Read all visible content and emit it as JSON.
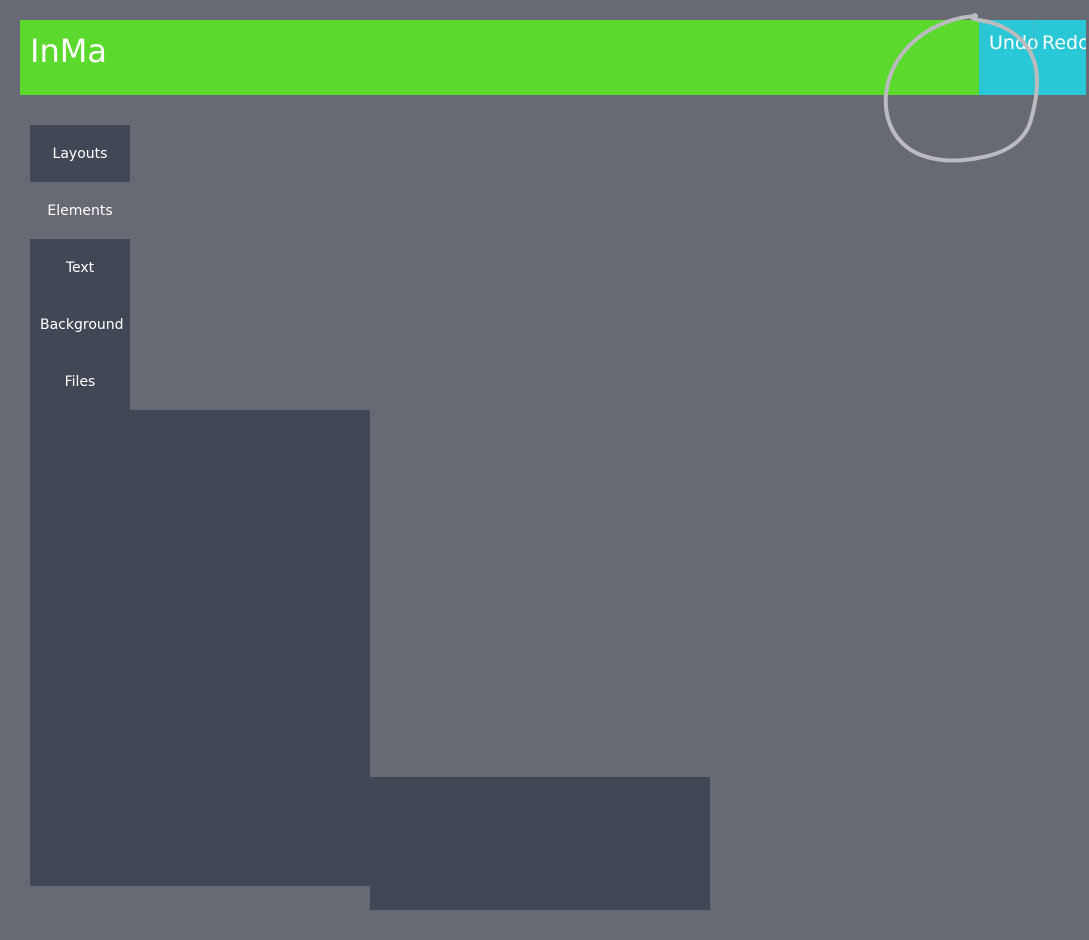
{
  "app": {
    "title": "InMa"
  },
  "header": {
    "background_color": "#5bd92c",
    "actions_color": "#2ac8d6",
    "undo_label": "Undo",
    "redo_label": "Redo"
  },
  "sidebar": {
    "tab_color": "#424755",
    "active_tab": "Elements",
    "items": [
      {
        "label": "Layouts"
      },
      {
        "label": "Elements"
      },
      {
        "label": "Text"
      },
      {
        "label": "Background"
      },
      {
        "label": "Files"
      }
    ]
  },
  "theme": {
    "page_background": "#676a72",
    "panel_color": "#424755",
    "annotation_color": "#b9bbbe"
  }
}
